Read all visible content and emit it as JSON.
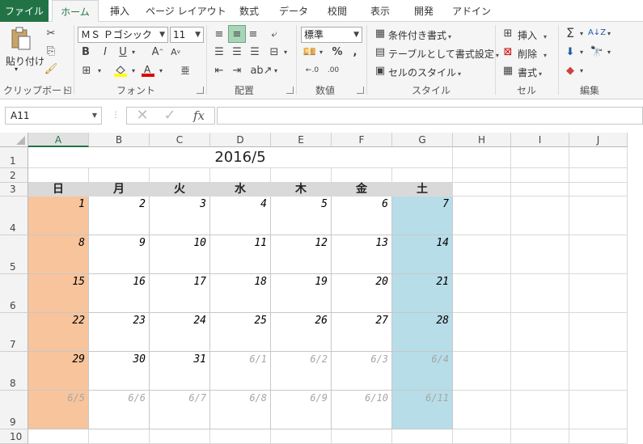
{
  "tabs": [
    "ファイル",
    "ホーム",
    "挿入",
    "ページ レイアウト",
    "数式",
    "データ",
    "校閲",
    "表示",
    "開発",
    "アドイン"
  ],
  "ribbon": {
    "clipboard": {
      "label": "クリップボード",
      "paste": "貼り付け"
    },
    "font": {
      "label": "フォント",
      "name": "ＭＳ Ｐゴシック",
      "size": "11",
      "bold": "B",
      "italic": "I",
      "underline": "U"
    },
    "alignment": {
      "label": "配置"
    },
    "number": {
      "label": "数値",
      "format": "標準"
    },
    "styles": {
      "label": "スタイル",
      "conditional": "条件付き書式",
      "table": "テーブルとして書式設定",
      "cell": "セルのスタイル"
    },
    "cells": {
      "label": "セル",
      "insert": "挿入",
      "delete": "削除",
      "format": "書式"
    },
    "editing": {
      "label": "編集"
    }
  },
  "formula_bar": {
    "name_box": "A11",
    "fx": "fx",
    "value": ""
  },
  "columns": [
    "A",
    "B",
    "C",
    "D",
    "E",
    "F",
    "G",
    "H",
    "I",
    "J"
  ],
  "rows": [
    "1",
    "2",
    "3",
    "4",
    "5",
    "6",
    "7",
    "8",
    "9",
    "10"
  ],
  "sheet": {
    "title": "2016/5",
    "weekdays": [
      "日",
      "月",
      "火",
      "水",
      "木",
      "金",
      "土"
    ],
    "weeks": [
      [
        "1",
        "2",
        "3",
        "4",
        "5",
        "6",
        "7"
      ],
      [
        "8",
        "9",
        "10",
        "11",
        "12",
        "13",
        "14"
      ],
      [
        "15",
        "16",
        "17",
        "18",
        "19",
        "20",
        "21"
      ],
      [
        "22",
        "23",
        "24",
        "25",
        "26",
        "27",
        "28"
      ],
      [
        "29",
        "30",
        "31",
        "6/1",
        "6/2",
        "6/3",
        "6/4"
      ],
      [
        "6/5",
        "6/6",
        "6/7",
        "6/8",
        "6/9",
        "6/10",
        "6/11"
      ]
    ],
    "sunday_color": "#f8c49c",
    "saturday_color": "#b7dde8",
    "header_color": "#d9d9d9"
  },
  "colors": {
    "accent": "#217346"
  }
}
